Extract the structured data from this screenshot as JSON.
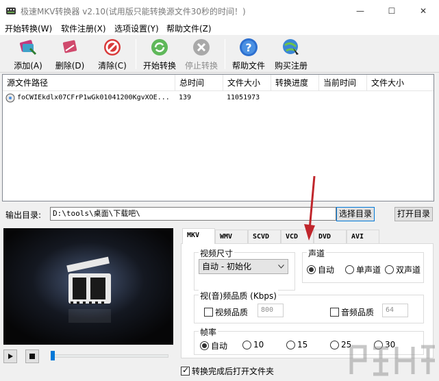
{
  "window": {
    "title": "极速MKV转换器 v2.10(试用版只能转换源文件30秒的时间！)",
    "min_glyph": "—",
    "max_glyph": "☐",
    "close_glyph": "✕"
  },
  "menu": [
    "开始转换(W)",
    "软件注册(X)",
    "选项设置(Y)",
    "帮助文件(Z)"
  ],
  "toolbar": {
    "add": "添加(A)",
    "delete": "删除(D)",
    "clear": "清除(C)",
    "start": "开始转换",
    "stop": "停止转换",
    "help": "帮助文件",
    "register": "购买注册"
  },
  "file_list": {
    "columns": [
      "源文件路径",
      "总时间",
      "文件大小",
      "转换进度",
      "当前时间",
      "文件大小"
    ],
    "rows": [
      {
        "path": "foCWIEkdlx07CFrP1wGk01041200KgvXOE...",
        "total_time": "139",
        "size": "11051973",
        "progress": "",
        "current_time": "",
        "out_size": ""
      }
    ]
  },
  "output": {
    "label": "输出目录:",
    "path": "D:\\tools\\桌面\\下载吧\\",
    "choose_button": "选择目录",
    "open_button": "打开目录"
  },
  "tabs": [
    "MKV",
    "WMV",
    "SCVD",
    "VCD",
    "DVD",
    "AVI"
  ],
  "active_tab": "MKV",
  "settings": {
    "video_size_title": "视频尺寸",
    "video_size_value": "自动 - 初始化",
    "audio_channel_title": "声道",
    "channels": [
      "自动",
      "单声道",
      "双声道"
    ],
    "selected_channel": "自动",
    "quality_title": "视(音)频品质 (Kbps)",
    "video_quality_label": "视频品质",
    "video_quality_value": "800",
    "audio_quality_label": "音频品质",
    "audio_quality_value": "64",
    "framerate_title": "帧率",
    "framerates": [
      "自动",
      "10",
      "15",
      "25",
      "30"
    ],
    "selected_framerate": "自动"
  },
  "open_folder_after": "转换完成后打开文件夹",
  "colors": {
    "accent": "#0078d7",
    "annotation_arrow": "#c0262c"
  }
}
